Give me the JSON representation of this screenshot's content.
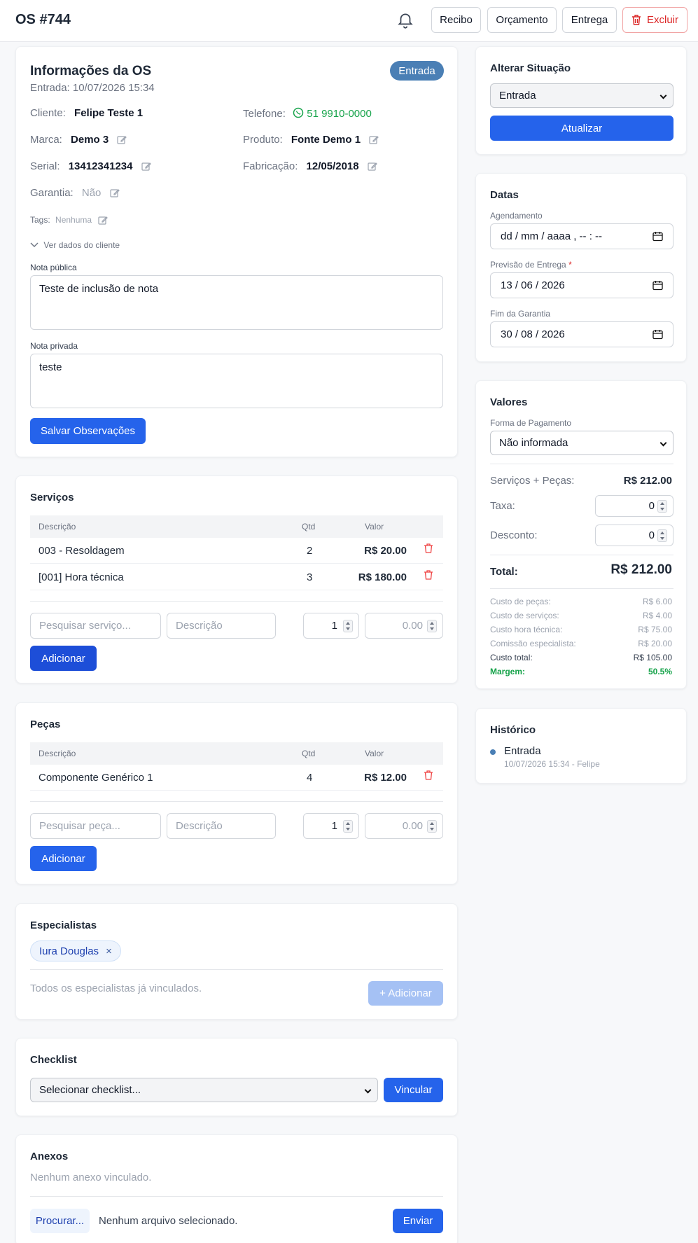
{
  "header": {
    "title": "OS #744",
    "buttons": {
      "recibo": "Recibo",
      "orcamento": "Orçamento",
      "entrega": "Entrega",
      "excluir": "Excluir"
    }
  },
  "info": {
    "title": "Informações da OS",
    "entrada_label": "Entrada: 10/07/2026 15:34",
    "status_badge": "Entrada",
    "cliente_label": "Cliente:",
    "cliente_value": "Felipe Teste 1",
    "telefone_label": "Telefone:",
    "telefone_value": "51 9910-0000",
    "marca_label": "Marca:",
    "marca_value": "Demo 3",
    "produto_label": "Produto:",
    "produto_value": "Fonte Demo 1",
    "serial_label": "Serial:",
    "serial_value": "13412341234",
    "fabricacao_label": "Fabricação:",
    "fabricacao_value": "12/05/2018",
    "garantia_label": "Garantia:",
    "garantia_value": "Não",
    "tags_label": "Tags:",
    "tags_value": "Nenhuma",
    "ver_dados": "Ver dados do cliente",
    "nota_publica_label": "Nota pública",
    "nota_publica_value": "Teste de inclusão de nota",
    "nota_privada_label": "Nota privada",
    "nota_privada_value": "teste",
    "salvar_btn": "Salvar Observações"
  },
  "servicos": {
    "title": "Serviços",
    "headers": {
      "descricao": "Descrição",
      "qtd": "Qtd",
      "valor": "Valor"
    },
    "rows": [
      {
        "descricao": "003 - Resoldagem",
        "qtd": "2",
        "valor": "R$ 20.00"
      },
      {
        "descricao": "[001] Hora técnica",
        "qtd": "3",
        "valor": "R$ 180.00"
      }
    ],
    "search_placeholder": "Pesquisar serviço...",
    "desc_placeholder": "Descrição",
    "qty_value": "1",
    "price_placeholder": "0.00",
    "add_btn": "Adicionar"
  },
  "pecas": {
    "title": "Peças",
    "headers": {
      "descricao": "Descrição",
      "qtd": "Qtd",
      "valor": "Valor"
    },
    "rows": [
      {
        "descricao": "Componente Genérico 1",
        "qtd": "4",
        "valor": "R$ 12.00"
      }
    ],
    "search_placeholder": "Pesquisar peça...",
    "desc_placeholder": "Descrição",
    "qty_value": "1",
    "price_placeholder": "0.00",
    "add_btn": "Adicionar"
  },
  "especialistas": {
    "title": "Especialistas",
    "chip": "Iura Douglas",
    "chip_close": "×",
    "note": "Todos os especialistas já vinculados.",
    "add_btn": "+ Adicionar"
  },
  "checklist": {
    "title": "Checklist",
    "select_value": "Selecionar checklist...",
    "vincular_btn": "Vincular"
  },
  "anexos": {
    "title": "Anexos",
    "empty": "Nenhum anexo vinculado.",
    "procurar_btn": "Procurar...",
    "no_file": "Nenhum arquivo selecionado.",
    "enviar_btn": "Enviar"
  },
  "situacao": {
    "title": "Alterar Situação",
    "select_value": "Entrada",
    "atualizar_btn": "Atualizar"
  },
  "datas": {
    "title": "Datas",
    "agendamento_label": "Agendamento",
    "agendamento_value": "dd / mm / aaaa ,  -- : --",
    "previsao_label": "Previsão de Entrega",
    "required_mark": "*",
    "previsao_value": "13 / 06 / 2026",
    "fim_garantia_label": "Fim da Garantia",
    "fim_garantia_value": "30 / 08 / 2026"
  },
  "valores": {
    "title": "Valores",
    "forma_label": "Forma de Pagamento",
    "forma_value": "Não informada",
    "servicos_pecas_label": "Serviços + Peças:",
    "servicos_pecas_value": "R$ 212.00",
    "taxa_label": "Taxa:",
    "taxa_value": "0",
    "desconto_label": "Desconto:",
    "desconto_value": "0",
    "total_label": "Total:",
    "total_value": "R$ 212.00",
    "costs": [
      {
        "label": "Custo de peças:",
        "value": "R$ 6.00"
      },
      {
        "label": "Custo de serviços:",
        "value": "R$ 4.00"
      },
      {
        "label": "Custo hora técnica:",
        "value": "R$ 75.00"
      },
      {
        "label": "Comissão especialista:",
        "value": "R$ 20.00"
      },
      {
        "label": "Custo total:",
        "value": "R$ 105.00"
      },
      {
        "label": "Margem:",
        "value": "50.5%"
      }
    ]
  },
  "historico": {
    "title": "Histórico",
    "entry_title": "Entrada",
    "entry_meta": "10/07/2026 15:34 - Felipe"
  },
  "colors": {
    "primary": "#2563eb",
    "badge": "#4a7fb5",
    "danger": "#dc2626",
    "whatsapp": "#16a34a",
    "margin": "#16a34a"
  }
}
